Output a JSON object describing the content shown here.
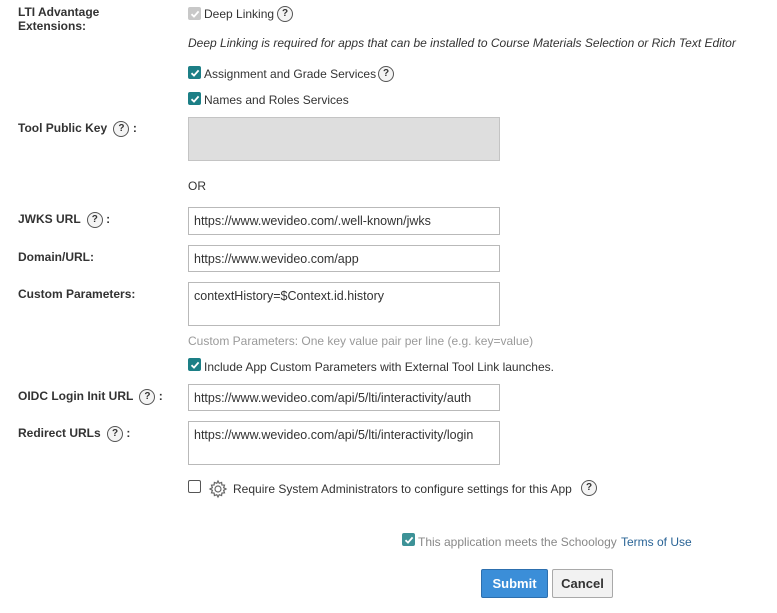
{
  "lti": {
    "label": "LTI Advantage Extensions:",
    "deep_linking_label": "Deep Linking",
    "deep_linking_note": "Deep Linking is required for apps that can be installed to Course Materials Selection or Rich Text Editor",
    "ags_label": "Assignment and Grade Services",
    "nrs_label": "Names and Roles Services"
  },
  "tool_public_key": {
    "label": "Tool Public Key",
    "value": ""
  },
  "or_text": "OR",
  "jwks": {
    "label": "JWKS URL",
    "value": "https://www.wevideo.com/.well-known/jwks"
  },
  "domain": {
    "label": "Domain/URL:",
    "value": "https://www.wevideo.com/app"
  },
  "custom_params": {
    "label": "Custom Parameters:",
    "value": "contextHistory=$Context.id.history",
    "hint": "Custom Parameters: One key value pair per line (e.g. key=value)",
    "include_label": "Include App Custom Parameters with External Tool Link launches."
  },
  "oidc": {
    "label": "OIDC Login Init URL",
    "value": "https://www.wevideo.com/api/5/lti/interactivity/auth"
  },
  "redirect": {
    "label": "Redirect URLs",
    "value": "https://www.wevideo.com/api/5/lti/interactivity/login"
  },
  "require_admin_label": "Require System Administrators to configure settings for this App",
  "terms": {
    "text": "This application meets the Schoology",
    "link": "Terms of Use"
  },
  "buttons": {
    "submit": "Submit",
    "cancel": "Cancel"
  },
  "help_glyph": "?",
  "colors": {
    "accent": "#1c7f86",
    "link": "#2a6496",
    "submit": "#3b8ed8"
  }
}
